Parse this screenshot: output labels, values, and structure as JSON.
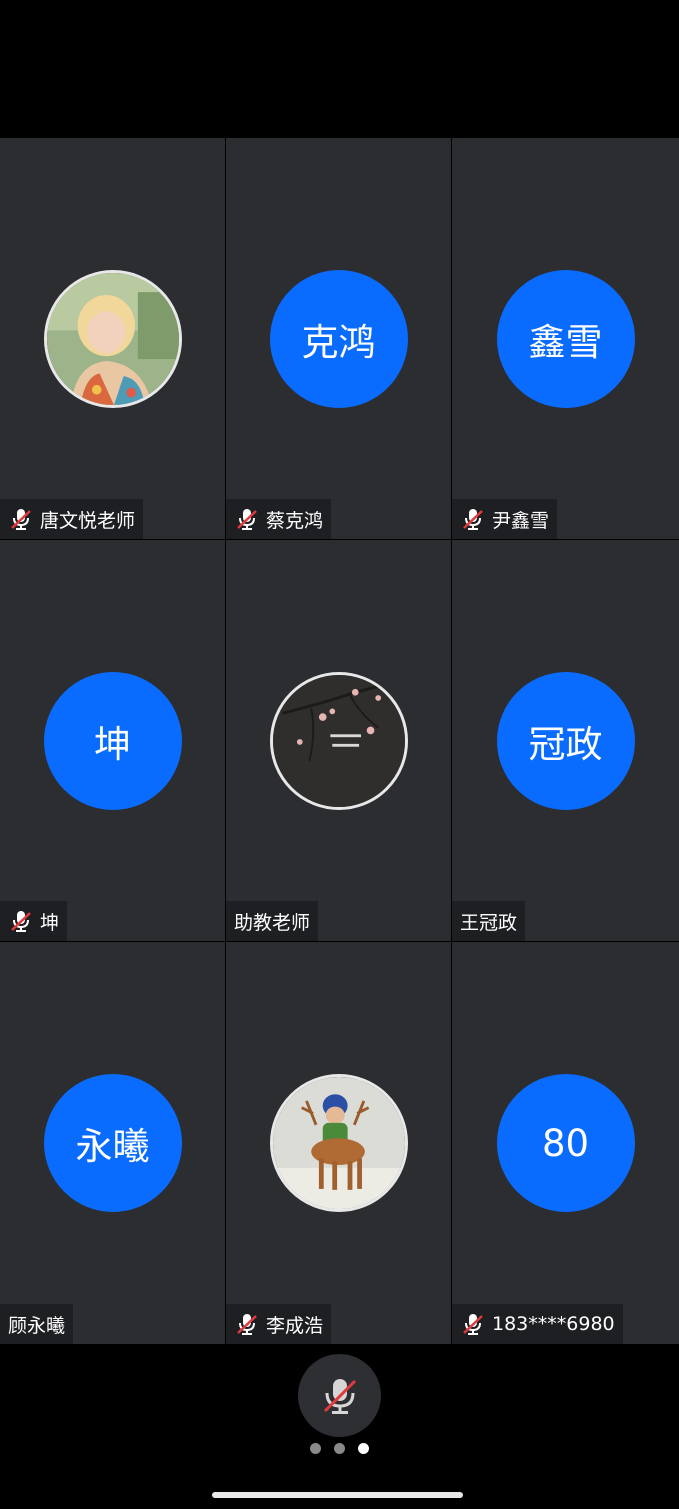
{
  "participants": [
    {
      "name": "唐文悦老师",
      "avatar_text": "",
      "avatar_type": "photo",
      "muted": true
    },
    {
      "name": "蔡克鸿",
      "avatar_text": "克鸿",
      "avatar_type": "initials",
      "muted": true
    },
    {
      "name": "尹鑫雪",
      "avatar_text": "鑫雪",
      "avatar_type": "initials",
      "muted": true
    },
    {
      "name": "坤",
      "avatar_text": "坤",
      "avatar_type": "initials",
      "muted": true
    },
    {
      "name": "助教老师",
      "avatar_text": "",
      "avatar_type": "photo",
      "muted": false
    },
    {
      "name": "王冠政",
      "avatar_text": "冠政",
      "avatar_type": "initials",
      "muted": false
    },
    {
      "name": "顾永曦",
      "avatar_text": "永曦",
      "avatar_type": "initials",
      "muted": false
    },
    {
      "name": "李成浩",
      "avatar_text": "",
      "avatar_type": "photo",
      "muted": true
    },
    {
      "name": "183****6980",
      "avatar_text": "80",
      "avatar_type": "initials",
      "muted": true
    }
  ],
  "controls": {
    "mic_icon": "mic-muted-icon",
    "mic_muted": true
  },
  "pagination": {
    "pages": 3,
    "current": 3
  },
  "colors": {
    "avatar_blue": "#0a6cff",
    "tile_bg": "#2b2d31",
    "mute_red": "#e0393e"
  }
}
